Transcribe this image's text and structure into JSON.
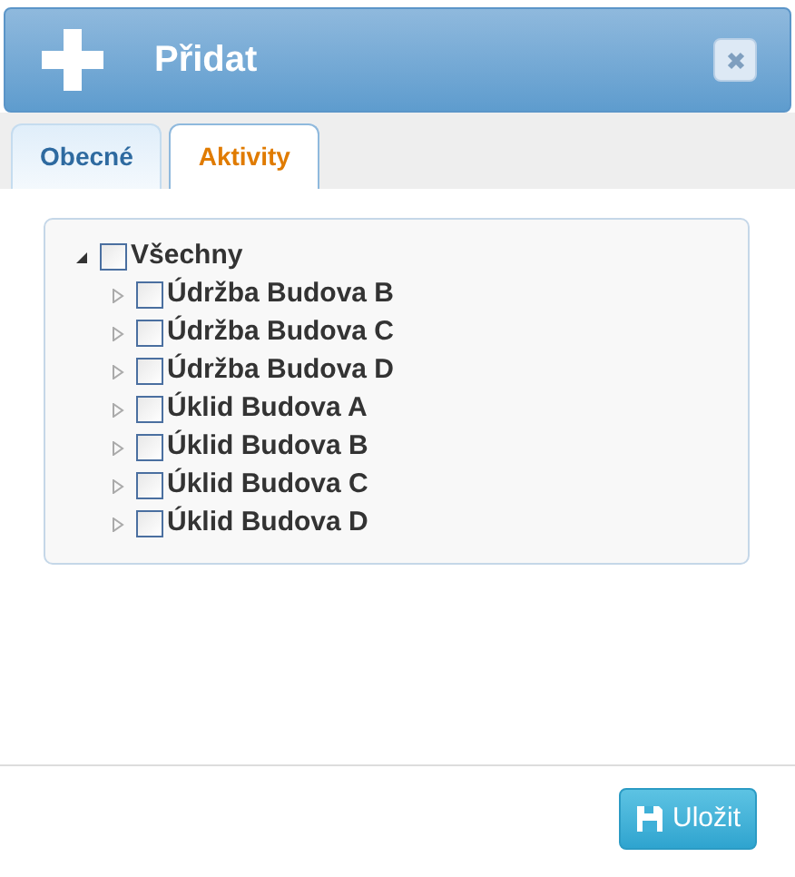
{
  "dialog": {
    "title": "Přidat"
  },
  "tabs": [
    {
      "label": "Obecné",
      "selected": false
    },
    {
      "label": "Aktivity",
      "selected": true
    }
  ],
  "tree": {
    "label": "Všechny",
    "checked": false,
    "expanded": true,
    "children": [
      {
        "label": "Údržba Budova B",
        "checked": false,
        "expanded": false
      },
      {
        "label": "Údržba Budova C",
        "checked": false,
        "expanded": false
      },
      {
        "label": "Údržba Budova D",
        "checked": false,
        "expanded": false
      },
      {
        "label": "Úklid Budova A",
        "checked": false,
        "expanded": false
      },
      {
        "label": "Úklid Budova B",
        "checked": false,
        "expanded": false
      },
      {
        "label": "Úklid Budova C",
        "checked": false,
        "expanded": false
      },
      {
        "label": "Úklid Budova D",
        "checked": false,
        "expanded": false
      }
    ]
  },
  "save_button": {
    "label": "Uložit"
  }
}
